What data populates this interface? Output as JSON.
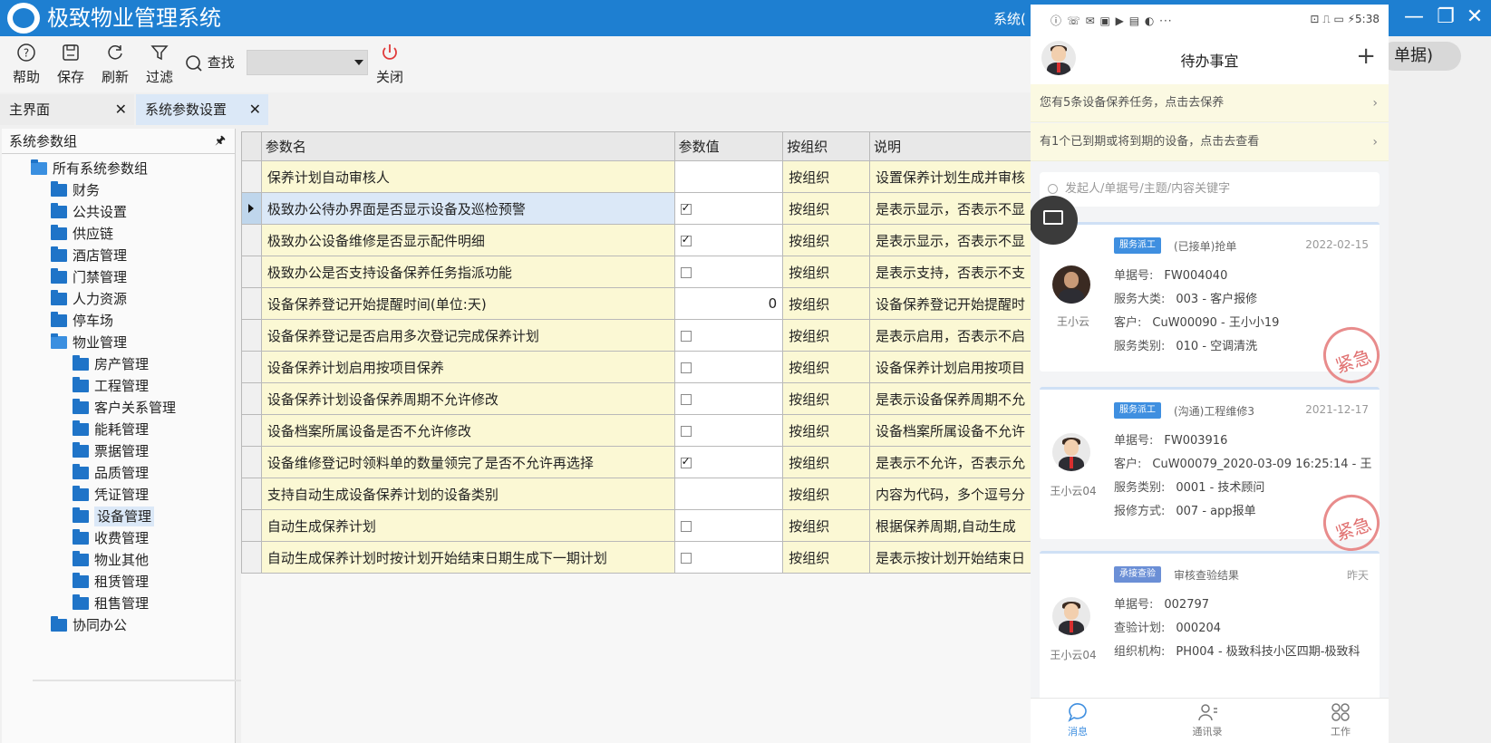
{
  "app": {
    "title": "极致物业管理系统",
    "system_text": "系统("
  },
  "toolbar": {
    "help": "帮助",
    "save": "保存",
    "refresh": "刷新",
    "filter": "过滤",
    "find": "查找",
    "find_value": "",
    "close": "关闭"
  },
  "tabs": [
    {
      "label": "主界面"
    },
    {
      "label": "系统参数设置"
    }
  ],
  "tree": {
    "header": "系统参数组",
    "pin": "📌",
    "root": "所有系统参数组",
    "level1": [
      "财务",
      "公共设置",
      "供应链",
      "酒店管理",
      "门禁管理",
      "人力资源",
      "停车场",
      "物业管理"
    ],
    "level2": [
      "房产管理",
      "工程管理",
      "客户关系管理",
      "能耗管理",
      "票据管理",
      "品质管理",
      "凭证管理",
      "设备管理",
      "收费管理",
      "物业其他",
      "租赁管理",
      "租售管理"
    ],
    "tail": "协同办公"
  },
  "grid": {
    "columns": [
      "参数名",
      "参数值",
      "按组织",
      "说明"
    ],
    "rows": [
      {
        "name": "保养计划自动审核人",
        "value": "",
        "type": "text",
        "org": "按组织",
        "desc": "设置保养计划生成并审核"
      },
      {
        "name": "极致办公待办界面是否显示设备及巡检预警",
        "value": true,
        "type": "check",
        "org": "按组织",
        "desc": "是表示显示，否表示不显"
      },
      {
        "name": "极致办公设备维修是否显示配件明细",
        "value": true,
        "type": "check",
        "org": "按组织",
        "desc": "是表示显示，否表示不显"
      },
      {
        "name": "极致办公是否支持设备保养任务指派功能",
        "value": false,
        "type": "check",
        "org": "按组织",
        "desc": "是表示支持，否表示不支"
      },
      {
        "name": "设备保养登记开始提醒时间(单位:天)",
        "value": "0",
        "type": "num",
        "org": "按组织",
        "desc": "设备保养登记开始提醒时"
      },
      {
        "name": "设备保养登记是否启用多次登记完成保养计划",
        "value": false,
        "type": "check",
        "org": "按组织",
        "desc": "是表示启用，否表示不启"
      },
      {
        "name": "设备保养计划启用按项目保养",
        "value": false,
        "type": "check",
        "org": "按组织",
        "desc": "设备保养计划启用按项目"
      },
      {
        "name": "设备保养计划设备保养周期不允许修改",
        "value": false,
        "type": "check",
        "org": "按组织",
        "desc": "是表示设备保养周期不允"
      },
      {
        "name": "设备档案所属设备是否不允许修改",
        "value": false,
        "type": "check",
        "org": "按组织",
        "desc": "设备档案所属设备不允许"
      },
      {
        "name": "设备维修登记时领料单的数量领完了是否不允许再选择",
        "value": true,
        "type": "check",
        "org": "按组织",
        "desc": "是表示不允许，否表示允"
      },
      {
        "name": "支持自动生成设备保养计划的设备类别",
        "value": "",
        "type": "text",
        "org": "按组织",
        "desc": "内容为代码，多个逗号分"
      },
      {
        "name": "自动生成保养计划",
        "value": false,
        "type": "check",
        "org": "按组织",
        "desc": "根据保养周期,自动生成"
      },
      {
        "name": "自动生成保养计划时按计划开始结束日期生成下一期计划",
        "value": false,
        "type": "check",
        "org": "按组织",
        "desc": "是表示按计划开始结束日"
      }
    ]
  },
  "phone": {
    "status_left": "ⓘ ☏ ✉ ▣ ▶ ▤ ◐ ···",
    "status_right": "⊡ ⎍ ▭ ⚡5:38",
    "title": "待办事宜",
    "plus": "+",
    "notices": [
      "您有5条设备保养任务，点击去保养",
      "有1个已到期或将到期的设备，点击去查看"
    ],
    "search_placeholder": "发起人/单据号/主题/内容关键字",
    "cards": [
      {
        "badge": "服务派工",
        "sub": "(已接单)抢单",
        "date": "2022-02-15",
        "user": "王小云",
        "lines": [
          [
            "单据号:",
            "FW004040"
          ],
          [
            "服务大类:",
            "003 - 客户报修"
          ],
          [
            "客户:",
            "CuW00090 - 王小小19"
          ],
          [
            "服务类别:",
            "010 - 空调清洗"
          ]
        ],
        "stamp": "紧急"
      },
      {
        "badge": "服务派工",
        "sub": "(沟通)工程维修3",
        "date": "2021-12-17",
        "user": "王小云04",
        "lines": [
          [
            "单据号:",
            "FW003916"
          ],
          [
            "客户:",
            "CuW00079_2020-03-09 16:25:14 - 王"
          ],
          [
            "服务类别:",
            "0001 - 技术顾问"
          ],
          [
            "报修方式:",
            "007 - app报单"
          ]
        ],
        "stamp": "紧急"
      },
      {
        "badge": "承接查验",
        "sub": "审核查验结果",
        "date": "昨天",
        "user": "王小云04",
        "lines": [
          [
            "单据号:",
            "002797"
          ],
          [
            "查验计划:",
            "000204"
          ],
          [
            "组织机构:",
            "PH004 - 极致科技小区四期-极致科"
          ]
        ],
        "stamp": ""
      }
    ],
    "tabs": [
      "消息",
      "通讯录",
      "工作"
    ]
  },
  "right_pill": "单据)"
}
